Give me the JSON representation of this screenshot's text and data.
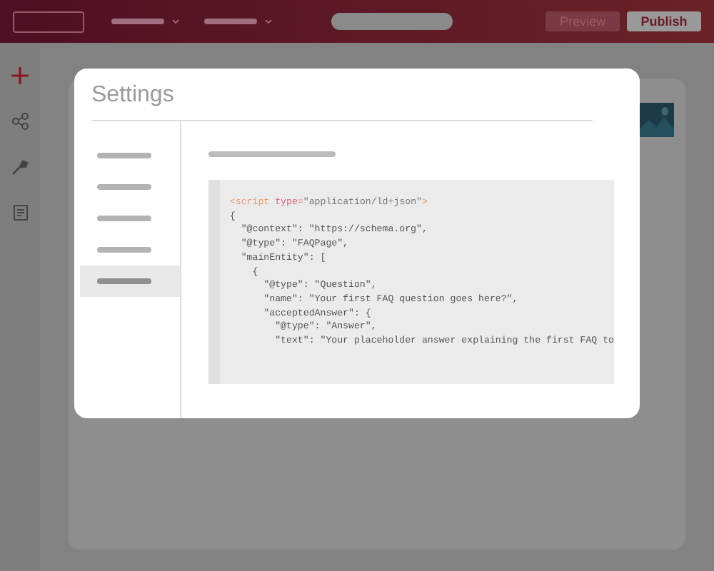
{
  "top_bar": {
    "buttons": [
      {
        "label": "Preview",
        "disabled": true
      },
      {
        "label": "Publish",
        "disabled": false
      }
    ]
  },
  "modal": {
    "title": "Settings",
    "menu": [
      {
        "selected": false
      },
      {
        "selected": false
      },
      {
        "selected": false
      },
      {
        "selected": false
      },
      {
        "selected": true
      }
    ],
    "code": [
      {
        "tokens": [
          {
            "kind": "tag",
            "text": "<script"
          },
          {
            "kind": "attr",
            "text": " type"
          },
          {
            "kind": "tag",
            "text": "="
          },
          {
            "kind": "value",
            "text": "\"application/ld+json\""
          },
          {
            "kind": "tag",
            "text": ">"
          }
        ]
      },
      {
        "tokens": [
          {
            "kind": "plain",
            "text": "{"
          }
        ]
      },
      {
        "tokens": [
          {
            "kind": "plain",
            "text": "  \"@context\": \"https://schema.org\","
          }
        ]
      },
      {
        "tokens": [
          {
            "kind": "plain",
            "text": "  \"@type\": \"FAQPage\","
          }
        ]
      },
      {
        "tokens": [
          {
            "kind": "plain",
            "text": "  \"mainEntity\": ["
          }
        ]
      },
      {
        "tokens": [
          {
            "kind": "plain",
            "text": "    {"
          }
        ]
      },
      {
        "tokens": [
          {
            "kind": "plain",
            "text": "      \"@type\": \"Question\","
          }
        ]
      },
      {
        "tokens": [
          {
            "kind": "plain",
            "text": "      \"name\": \"Your first FAQ question goes here?\","
          }
        ]
      },
      {
        "tokens": [
          {
            "kind": "plain",
            "text": "      \"acceptedAnswer\": {"
          }
        ]
      },
      {
        "tokens": [
          {
            "kind": "plain",
            "text": "        \"@type\": \"Answer\","
          }
        ]
      },
      {
        "tokens": [
          {
            "kind": "plain",
            "text": "        \"text\": \"Your placeholder answer explaining the first FAQ to"
          }
        ]
      }
    ]
  }
}
